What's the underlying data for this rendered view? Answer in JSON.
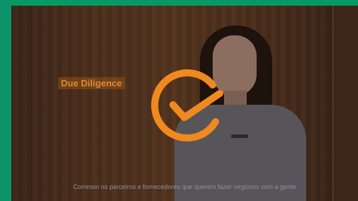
{
  "video": {
    "label_tag": "Due Diligence",
    "subtitle": "Common os parceiros e fornecedores que querem fazer negócios com a gente"
  },
  "colors": {
    "frame_green": "#0b8d63",
    "accent_orange": "#f0891f"
  },
  "icons": {
    "overlay": "checkmark-circle-icon"
  }
}
